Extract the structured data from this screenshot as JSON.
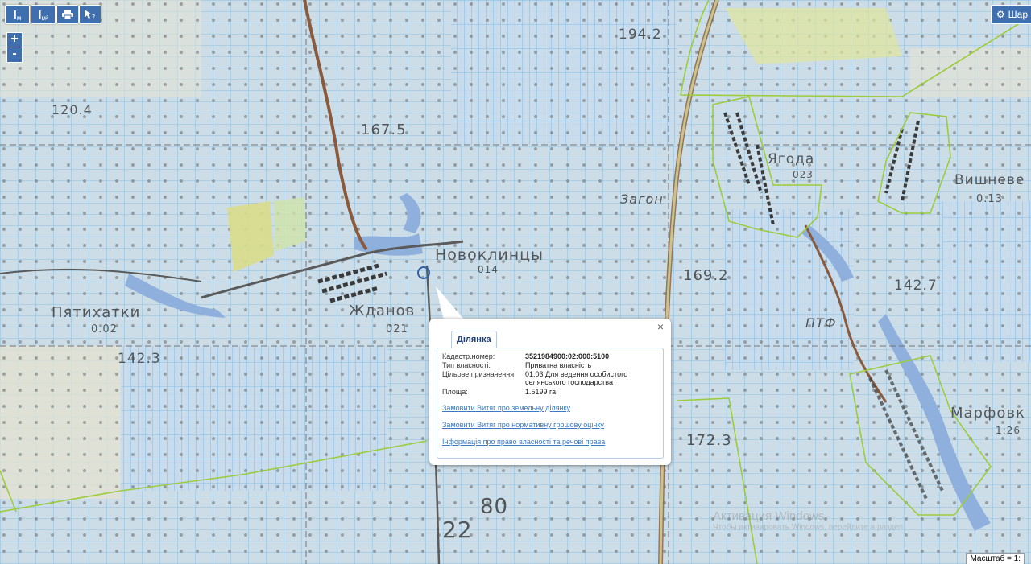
{
  "toolbar": {
    "measure_length_label": "м",
    "measure_area_label": "м²",
    "print_icon": "printer-icon",
    "help_icon": "help-cursor-icon"
  },
  "zoom": {
    "in_label": "+",
    "out_label": "-"
  },
  "layers": {
    "label": "Шар"
  },
  "map_labels": {
    "top_elev": "194.2",
    "left_elev": "120.4",
    "mid_elev": "167.5",
    "zagon": "Загон",
    "novoklinci": "Новоклинцы",
    "novoklinci_num": "014",
    "pyatihatki": "Пятихатки",
    "pyatihatki_num": "0.02",
    "zhdanov": "Жданов",
    "zhdanov_num": "021",
    "elev_423": "142.3",
    "elev_1692": "169.2",
    "yagoda": "Ягода",
    "yagoda_num": "023",
    "vishneve": "Вишневе",
    "vishneve_num": "0.13",
    "elev_1427": "142.7",
    "ptf": "ПТФ",
    "marfovka": "Марфовк",
    "marfovka_num": "1:26",
    "elev_1723": "172.3",
    "num_80": "80",
    "num_22": "22"
  },
  "popup": {
    "tab_label": "Ділянка",
    "close_symbol": "×",
    "rows": [
      {
        "label": "Кадастр.номер:",
        "value": "3521984900:02:000:5100"
      },
      {
        "label": "Тип власності:",
        "value": "Приватна власність"
      },
      {
        "label": "Цільове призначення:",
        "value": "01.03 Для ведення особистого селянського господарства"
      },
      {
        "label": "Площа:",
        "value": "1.5199 га"
      }
    ],
    "links": [
      "Замовити Витяг про земельну ділянку",
      "Замовити Витяг про нормативну грошову оцінку",
      "Інформація про право власності та речові права"
    ]
  },
  "watermark": {
    "line1": "Активация Windows",
    "line2": "Чтобы активировать Windows, перейдите в раздел"
  },
  "scale": {
    "label": "Масштаб = 1:"
  },
  "colors": {
    "parcel_fill": "#c5ddef",
    "parcel_line": "#5aaee8",
    "boundary_green": "#9ccc3c",
    "road_brown": "#8b5a3c",
    "water_blue": "#8fb0dc",
    "ui_blue": "#3f6fae"
  }
}
